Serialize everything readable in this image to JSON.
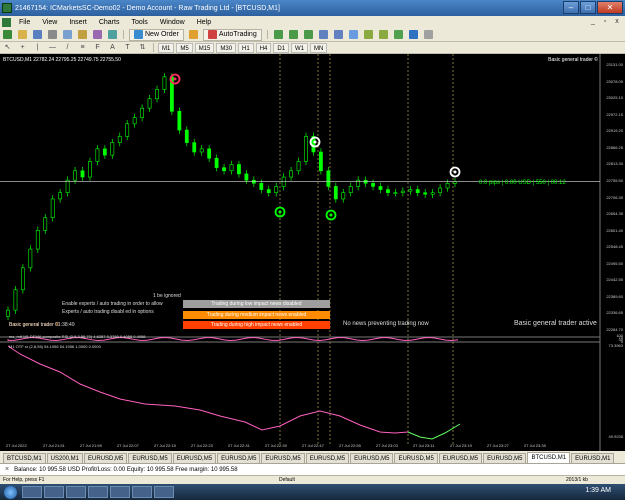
{
  "window": {
    "title": "21467154: ICMarketsSC-Demo02 - Demo Account - Raw Trading Ltd - [BTCUSD,M1]",
    "buttons": {
      "minimize": "–",
      "maximize": "□",
      "close": "✕"
    }
  },
  "menu": {
    "items": [
      "File",
      "View",
      "Insert",
      "Charts",
      "Tools",
      "Window",
      "Help"
    ],
    "mdi_buttons": {
      "minimize": "_",
      "restore": "▫",
      "close": "x"
    }
  },
  "toolbar": {
    "new_order_label": "New Order",
    "autotrading_label": "AutoTrading",
    "timeframes": [
      "M1",
      "M5",
      "M15",
      "M30",
      "H1",
      "H4",
      "D1",
      "W1",
      "MN"
    ]
  },
  "chart": {
    "symbol_info": "BTCUSD,M1  22782.24 22795.25 22749.75 22755.50",
    "indicator_name": "Basic general trader ©",
    "price_label": "0.0 pips | 0.00 USD | 550 | 00:12",
    "signal_note": "1 be ignored",
    "expert_msg_1": "Enable experts / auto trading in order to allow",
    "expert_msg_2": "Experts / auto trading disabl ed in options",
    "status_line": "Basic general trader ©",
    "timestamp_line": "Basic general trader 01:38:49",
    "news_low": "Trading during low impact news disabled",
    "news_medium": "Trading during medium impact news enabled",
    "news_high": "Trading during high impact news enabled",
    "no_news": "No news preventing trading now",
    "active_label": "Basic general trader active",
    "osc_title": "ms_mtf M1 DEMA composite RSI (2,8,3,55,70)  4.6257 0.3780 0.4058 0.4058",
    "otf_title": "M1 OTF sr (2,8,55)  54.1956 54.1956 1.0000 0.0000",
    "price_axis": [
      "23131.00",
      "23078.05",
      "23025.10",
      "22972.15",
      "22919.20",
      "22866.25",
      "22813.30",
      "22755.50",
      "22706.30",
      "22654.35",
      "22601.40",
      "22548.45",
      "22495.50",
      "22442.55",
      "22389.60",
      "22336.65",
      "22284.70"
    ],
    "osc_axis": [
      "100",
      "70",
      "30",
      "0"
    ],
    "otf_axis": [
      "73.3963",
      "49.9235"
    ],
    "time_axis": [
      "27 Jul 2022",
      "27 Jul 21:51",
      "27 Jul 21:59",
      "27 Jul 22:07",
      "27 Jul 22:15",
      "27 Jul 22:23",
      "27 Jul 22:31",
      "27 Jul 22:39",
      "27 Jul 22:47",
      "27 Jul 22:55",
      "27 Jul 23:03",
      "27 Jul 23:11",
      "27 Jul 23:19",
      "27 Jul 23:27",
      "27 Jul 23:35"
    ],
    "colors": {
      "bull": "#00ff00",
      "bear": "#00ff00",
      "signal_red": "#ff3060",
      "line_pink": "#ff60c0",
      "line_green": "#60ff60"
    }
  },
  "chart_data": {
    "type": "line",
    "title": "BTCUSD,M1",
    "ylim": [
      22284.7,
      23131.0
    ],
    "close_series": [
      22345,
      22410,
      22480,
      22540,
      22600,
      22640,
      22700,
      22720,
      22760,
      22790,
      22770,
      22820,
      22860,
      22840,
      22880,
      22900,
      22940,
      22960,
      22990,
      23020,
      23050,
      23090,
      22980,
      22920,
      22880,
      22850,
      22860,
      22830,
      22800,
      22790,
      22810,
      22780,
      22760,
      22750,
      22730,
      22720,
      22740,
      22770,
      22790,
      22820,
      22900,
      22850,
      22790,
      22740,
      22700,
      22720,
      22740,
      22760,
      22750,
      22740,
      22730,
      22720,
      22720,
      22725,
      22730,
      22720,
      22715,
      22720,
      22735,
      22750,
      22755
    ]
  },
  "tabs": [
    "BTCUSD,M1",
    "US200,M1",
    "EURUSD,M5",
    "EURUSD,M5",
    "EURUSD,M5",
    "EURUSD,M5",
    "EURUSD,M5",
    "EURUSD,M5",
    "EURUSD,M5",
    "EURUSD,M5",
    "EURUSD,M5",
    "EURUSD,M5",
    "BTCUSD,M1",
    "EURUSD,M1"
  ],
  "active_tab_index": 12,
  "terminal": {
    "close": "×",
    "balance_line": "Balance: 10 995.58 USD  Profit/Loss: 0.00  Equity: 10 995.58  Free margin: 10 995.58"
  },
  "statusbar": {
    "help": "For Help, press F1",
    "profile": "Default",
    "traffic": "2013/1 kb"
  },
  "taskbar": {
    "clock": "1:39 AM"
  }
}
